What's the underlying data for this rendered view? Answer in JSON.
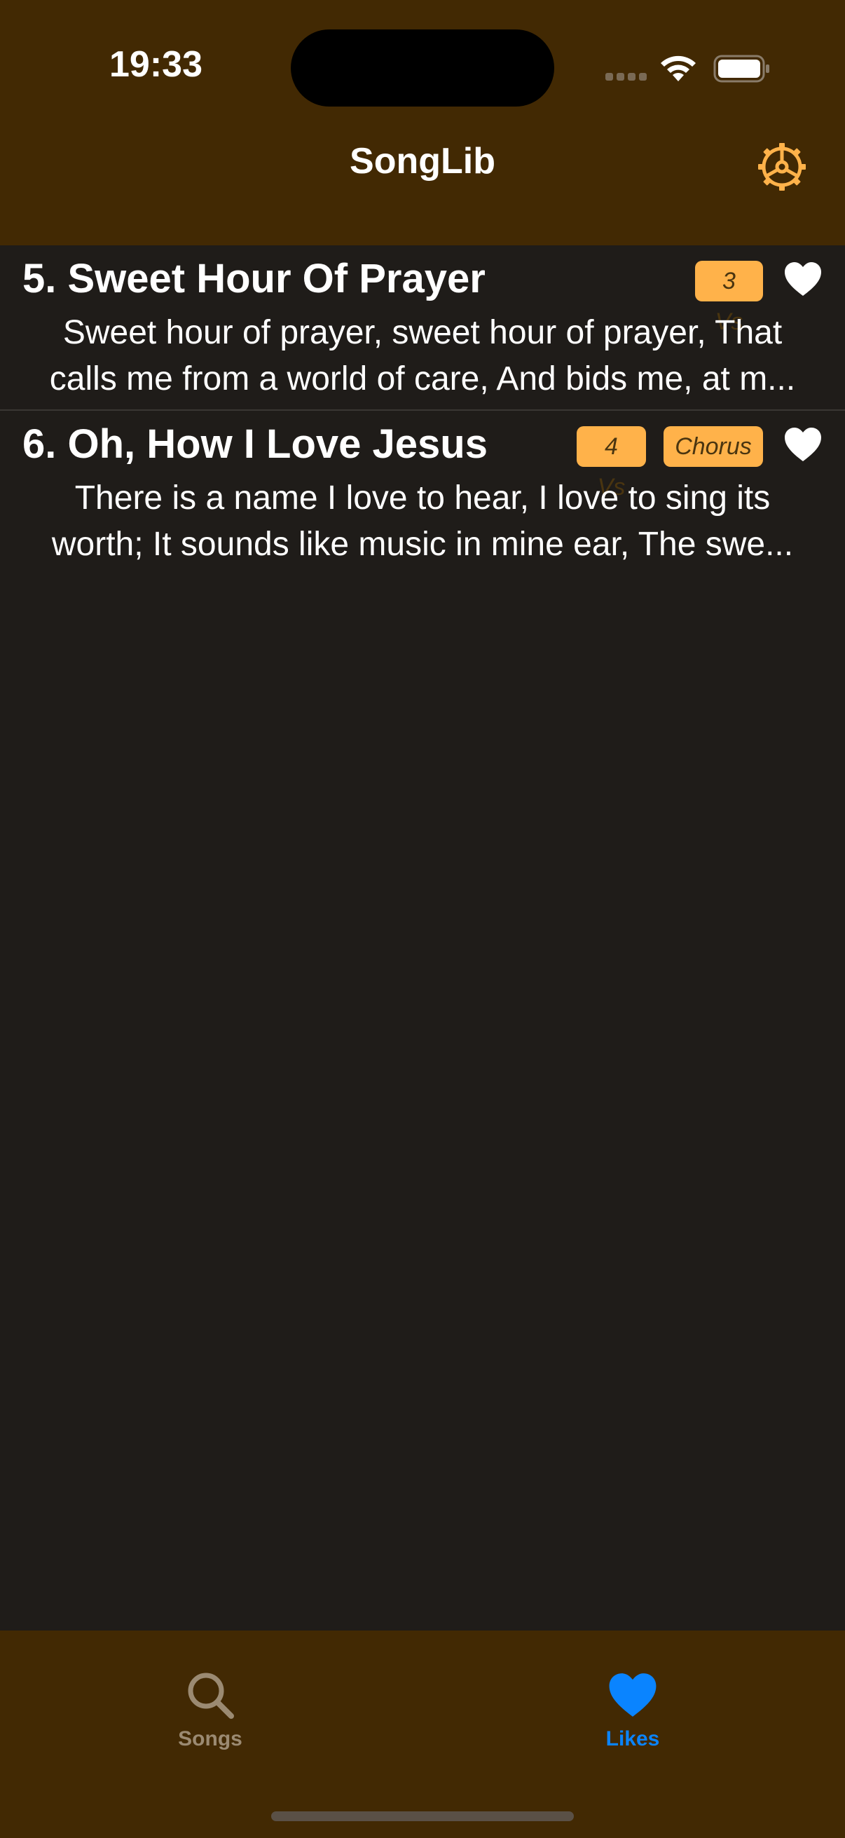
{
  "status_bar": {
    "time": "19:33"
  },
  "header": {
    "title": "SongLib",
    "settings_icon": "gear-icon"
  },
  "songs": [
    {
      "title": "5. Sweet Hour Of Prayer",
      "badges": [
        "3 Vs"
      ],
      "preview_line1": "Sweet hour of prayer, sweet hour of prayer, That",
      "preview_line2": "calls me from a world of care, And bids me, at m...",
      "liked": true
    },
    {
      "title": "6. Oh, How I Love Jesus",
      "badges": [
        "4 Vs",
        "Chorus"
      ],
      "preview_line1": "There is a name I love to hear, I love to sing its",
      "preview_line2": "worth; It sounds like music in mine ear, The swe...",
      "liked": true
    }
  ],
  "tabs": {
    "songs": {
      "label": "Songs",
      "icon": "search-icon",
      "active": false
    },
    "likes": {
      "label": "Likes",
      "icon": "heart-icon",
      "active": true
    }
  },
  "colors": {
    "header_bg": "#422903",
    "list_bg": "#1f1c19",
    "accent": "#ffb24a",
    "active_tab": "#0a84ff",
    "inactive_tab": "#9b8a72"
  }
}
